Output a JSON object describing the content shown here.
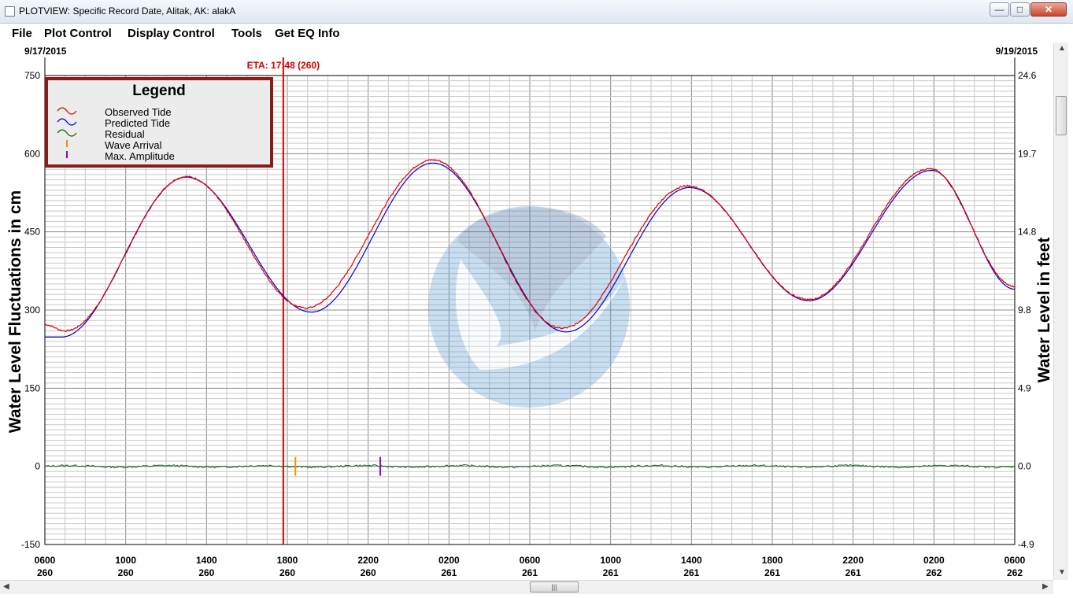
{
  "window": {
    "title": "PLOTVIEW: Specific Record Date, Alitak, AK: alakA",
    "minimize_glyph": "—",
    "maximize_glyph": "□",
    "close_glyph": "✕"
  },
  "menu": [
    "File",
    "Plot Control",
    "Display Control",
    "Tools",
    "Get EQ Info"
  ],
  "dates": {
    "start": "9/17/2015",
    "end": "9/19/2015"
  },
  "eta_label": "ETA: 17:48 (260)",
  "legend": {
    "title": "Legend",
    "items": [
      {
        "label": "Observed Tide",
        "color": "#e00000",
        "marker": "wave"
      },
      {
        "label": "Predicted Tide",
        "color": "#0000cc",
        "marker": "wave"
      },
      {
        "label": "Residual",
        "color": "#006600",
        "marker": "wave"
      },
      {
        "label": "Wave Arrival",
        "color": "#ff8c00",
        "marker": "bar"
      },
      {
        "label": "Max. Amplitude",
        "color": "#9900cc",
        "marker": "bar"
      }
    ]
  },
  "scroll": {
    "h_thumb_glyph": "|||"
  },
  "chart_data": {
    "type": "line",
    "ylabel": "Water Level Fluctuations in cm",
    "y2label": "Water Level in feet",
    "ylim": [
      -150,
      750
    ],
    "y2lim": [
      -4.9,
      24.6
    ],
    "y_ticks": [
      "750",
      "600",
      "450",
      "300",
      "150",
      "0",
      "-150"
    ],
    "y2_ticks": [
      "24.6",
      "19.7",
      "14.8",
      "9.8",
      "4.9",
      "0.0",
      "-4.9"
    ],
    "xlim_hours": [
      0,
      48
    ],
    "x_ticks": [
      {
        "time": "0600",
        "day": "260"
      },
      {
        "time": "1000",
        "day": "260"
      },
      {
        "time": "1400",
        "day": "260"
      },
      {
        "time": "1800",
        "day": "260"
      },
      {
        "time": "2200",
        "day": "260"
      },
      {
        "time": "0200",
        "day": "261"
      },
      {
        "time": "0600",
        "day": "261"
      },
      {
        "time": "1000",
        "day": "261"
      },
      {
        "time": "1400",
        "day": "261"
      },
      {
        "time": "1800",
        "day": "261"
      },
      {
        "time": "2200",
        "day": "261"
      },
      {
        "time": "0200",
        "day": "262"
      },
      {
        "time": "0600",
        "day": "262"
      }
    ],
    "eta_hour": 11.8,
    "wave_arrival_hour": 12.4,
    "max_amplitude_hour": 16.6,
    "predicted_extrema": [
      {
        "hour": 0.8,
        "value": 248
      },
      {
        "hour": 7.0,
        "value": 555
      },
      {
        "hour": 13.2,
        "value": 296
      },
      {
        "hour": 19.2,
        "value": 582
      },
      {
        "hour": 25.8,
        "value": 258
      },
      {
        "hour": 31.9,
        "value": 535
      },
      {
        "hour": 37.8,
        "value": 318
      },
      {
        "hour": 43.9,
        "value": 568
      },
      {
        "hour": 48.0,
        "value": 340
      }
    ],
    "observed_extrema": [
      {
        "hour": 0.0,
        "value": 272
      },
      {
        "hour": 1.0,
        "value": 260
      },
      {
        "hour": 7.0,
        "value": 556
      },
      {
        "hour": 12.9,
        "value": 304
      },
      {
        "hour": 19.2,
        "value": 588
      },
      {
        "hour": 25.6,
        "value": 265
      },
      {
        "hour": 31.8,
        "value": 538
      },
      {
        "hour": 37.8,
        "value": 320
      },
      {
        "hour": 43.8,
        "value": 571
      },
      {
        "hour": 48.0,
        "value": 345
      }
    ],
    "residual_baseline": 0
  }
}
